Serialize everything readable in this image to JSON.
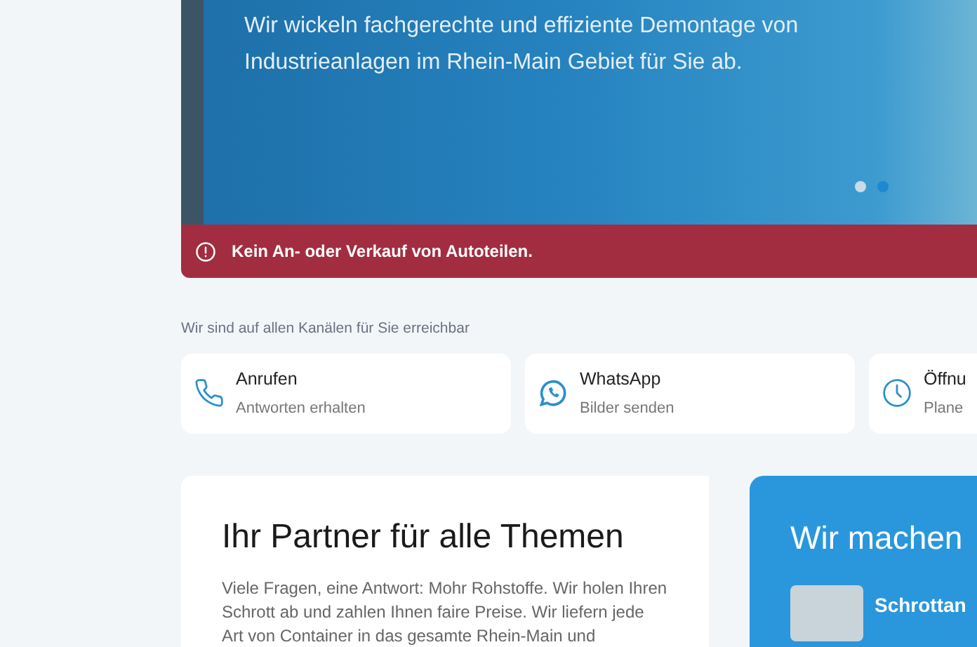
{
  "hero": {
    "text": "Wir wickeln fachgerechte und effiziente Demontage von Industrieanlagen im Rhein-Main Gebiet für Sie ab.",
    "slide_dots": [
      {
        "selected": false
      },
      {
        "selected": true
      }
    ],
    "notice": "Kein An- oder Verkauf von Autoteilen."
  },
  "contact": {
    "intro": "Wir sind auf allen Kanälen für Sie erreichbar",
    "cards": [
      {
        "kind": "phone",
        "title": "Anrufen",
        "subtitle": "Antworten erhalten"
      },
      {
        "kind": "whatsapp",
        "title": "WhatsApp",
        "subtitle": "Bilder senden"
      },
      {
        "kind": "clock",
        "title": "Öffnu",
        "subtitle": "Plane"
      }
    ]
  },
  "partner": {
    "heading": "Ihr Partner für alle Themen",
    "text": "Viele Fragen, eine Antwort: Mohr Rohstoffe. Wir holen Ihren Schrott ab und zahlen Ihnen faire Preise. Wir liefern jede Art von Container in das gesamte Rhein-Main und"
  },
  "services": {
    "heading": "Wir machen",
    "items": [
      {
        "title": "Schrottan"
      }
    ]
  }
}
